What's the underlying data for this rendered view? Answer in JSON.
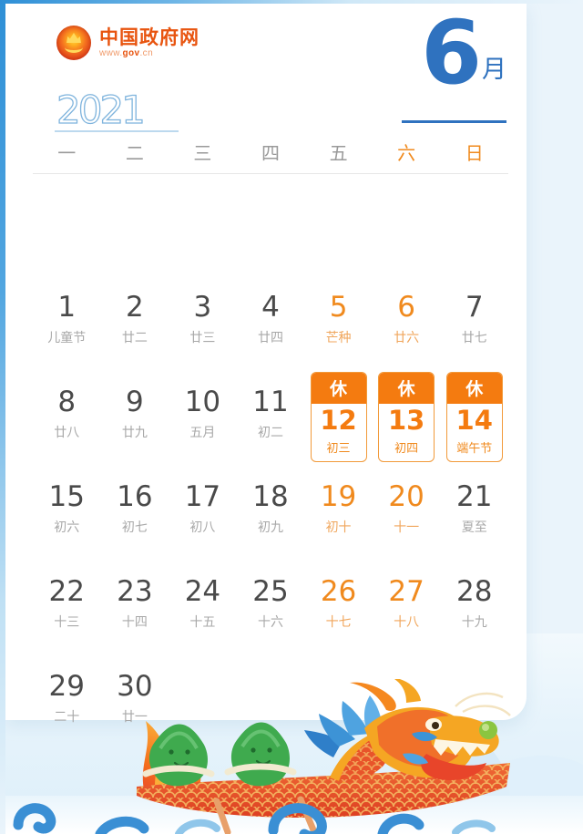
{
  "brand": {
    "name": "中国政府网",
    "url_prefix": "www.",
    "url_domain": "gov",
    "url_suffix": ".cn",
    "emblem_icon": "china-national-emblem-icon",
    "accent_color": "#e8540f"
  },
  "header": {
    "year": "2021",
    "month_number": "6",
    "month_char": "月",
    "month_color": "#2f72bf"
  },
  "weekdays": [
    {
      "label": "一",
      "weekend": false
    },
    {
      "label": "二",
      "weekend": false
    },
    {
      "label": "三",
      "weekend": false
    },
    {
      "label": "四",
      "weekend": false
    },
    {
      "label": "五",
      "weekend": false
    },
    {
      "label": "六",
      "weekend": true
    },
    {
      "label": "日",
      "weekend": true
    }
  ],
  "colors": {
    "weekday_gray": "#9a9a9a",
    "weekend_orange": "#f08a1e",
    "rest_orange": "#f47b10",
    "rest_border": "#f29a3a",
    "day_text": "#4a4a4a",
    "lunar_text": "#a8a8a8",
    "page_background": "#eaf4fb",
    "card_background": "#ffffff"
  },
  "rest_badge_label": "休",
  "days": [
    {
      "num": "",
      "sub": "",
      "empty": true
    },
    {
      "num": "",
      "sub": "",
      "empty": true
    },
    {
      "num": "",
      "sub": "",
      "empty": true
    },
    {
      "num": "",
      "sub": "",
      "empty": true
    },
    {
      "num": "",
      "sub": "",
      "empty": true
    },
    {
      "num": "",
      "sub": "",
      "empty": true
    },
    {
      "num": "",
      "sub": "",
      "empty": true
    },
    {
      "num": "1",
      "sub": "儿童节",
      "weekend": false,
      "rest": false
    },
    {
      "num": "2",
      "sub": "廿二",
      "weekend": false,
      "rest": false
    },
    {
      "num": "3",
      "sub": "廿三",
      "weekend": false,
      "rest": false
    },
    {
      "num": "4",
      "sub": "廿四",
      "weekend": false,
      "rest": false
    },
    {
      "num": "5",
      "sub": "芒种",
      "weekend": true,
      "rest": false
    },
    {
      "num": "6",
      "sub": "廿六",
      "weekend": true,
      "rest": false
    },
    {
      "num": "7",
      "sub": "廿七",
      "weekend": false,
      "rest": false
    },
    {
      "num": "8",
      "sub": "廿八",
      "weekend": false,
      "rest": false
    },
    {
      "num": "9",
      "sub": "廿九",
      "weekend": false,
      "rest": false
    },
    {
      "num": "10",
      "sub": "五月",
      "weekend": false,
      "rest": false
    },
    {
      "num": "11",
      "sub": "初二",
      "weekend": false,
      "rest": false
    },
    {
      "num": "12",
      "sub": "初三",
      "weekend": true,
      "rest": true
    },
    {
      "num": "13",
      "sub": "初四",
      "weekend": true,
      "rest": true
    },
    {
      "num": "14",
      "sub": "端午节",
      "weekend": false,
      "rest": true
    },
    {
      "num": "15",
      "sub": "初六",
      "weekend": false,
      "rest": false
    },
    {
      "num": "16",
      "sub": "初七",
      "weekend": false,
      "rest": false
    },
    {
      "num": "17",
      "sub": "初八",
      "weekend": false,
      "rest": false
    },
    {
      "num": "18",
      "sub": "初九",
      "weekend": false,
      "rest": false
    },
    {
      "num": "19",
      "sub": "初十",
      "weekend": true,
      "rest": false
    },
    {
      "num": "20",
      "sub": "十一",
      "weekend": true,
      "rest": false
    },
    {
      "num": "21",
      "sub": "夏至",
      "weekend": false,
      "rest": false
    },
    {
      "num": "22",
      "sub": "十三",
      "weekend": false,
      "rest": false
    },
    {
      "num": "23",
      "sub": "十四",
      "weekend": false,
      "rest": false
    },
    {
      "num": "24",
      "sub": "十五",
      "weekend": false,
      "rest": false
    },
    {
      "num": "25",
      "sub": "十六",
      "weekend": false,
      "rest": false
    },
    {
      "num": "26",
      "sub": "十七",
      "weekend": true,
      "rest": false
    },
    {
      "num": "27",
      "sub": "十八",
      "weekend": true,
      "rest": false
    },
    {
      "num": "28",
      "sub": "十九",
      "weekend": false,
      "rest": false
    },
    {
      "num": "29",
      "sub": "二十",
      "weekend": false,
      "rest": false
    },
    {
      "num": "30",
      "sub": "廿一",
      "weekend": false,
      "rest": false
    },
    {
      "num": "",
      "sub": "",
      "empty": true
    },
    {
      "num": "",
      "sub": "",
      "empty": true
    },
    {
      "num": "",
      "sub": "",
      "empty": true
    },
    {
      "num": "",
      "sub": "",
      "empty": true
    }
  ],
  "illustration": {
    "name": "dragon-boat-with-zongzi",
    "dragon_body_color": "#e8542a",
    "dragon_scale_color": "#f5a623",
    "zongzi_color": "#3faa4e",
    "wave_color": "#3a8fd4",
    "mountain_color": "#d3e9f7",
    "zongzi_count": 2
  }
}
